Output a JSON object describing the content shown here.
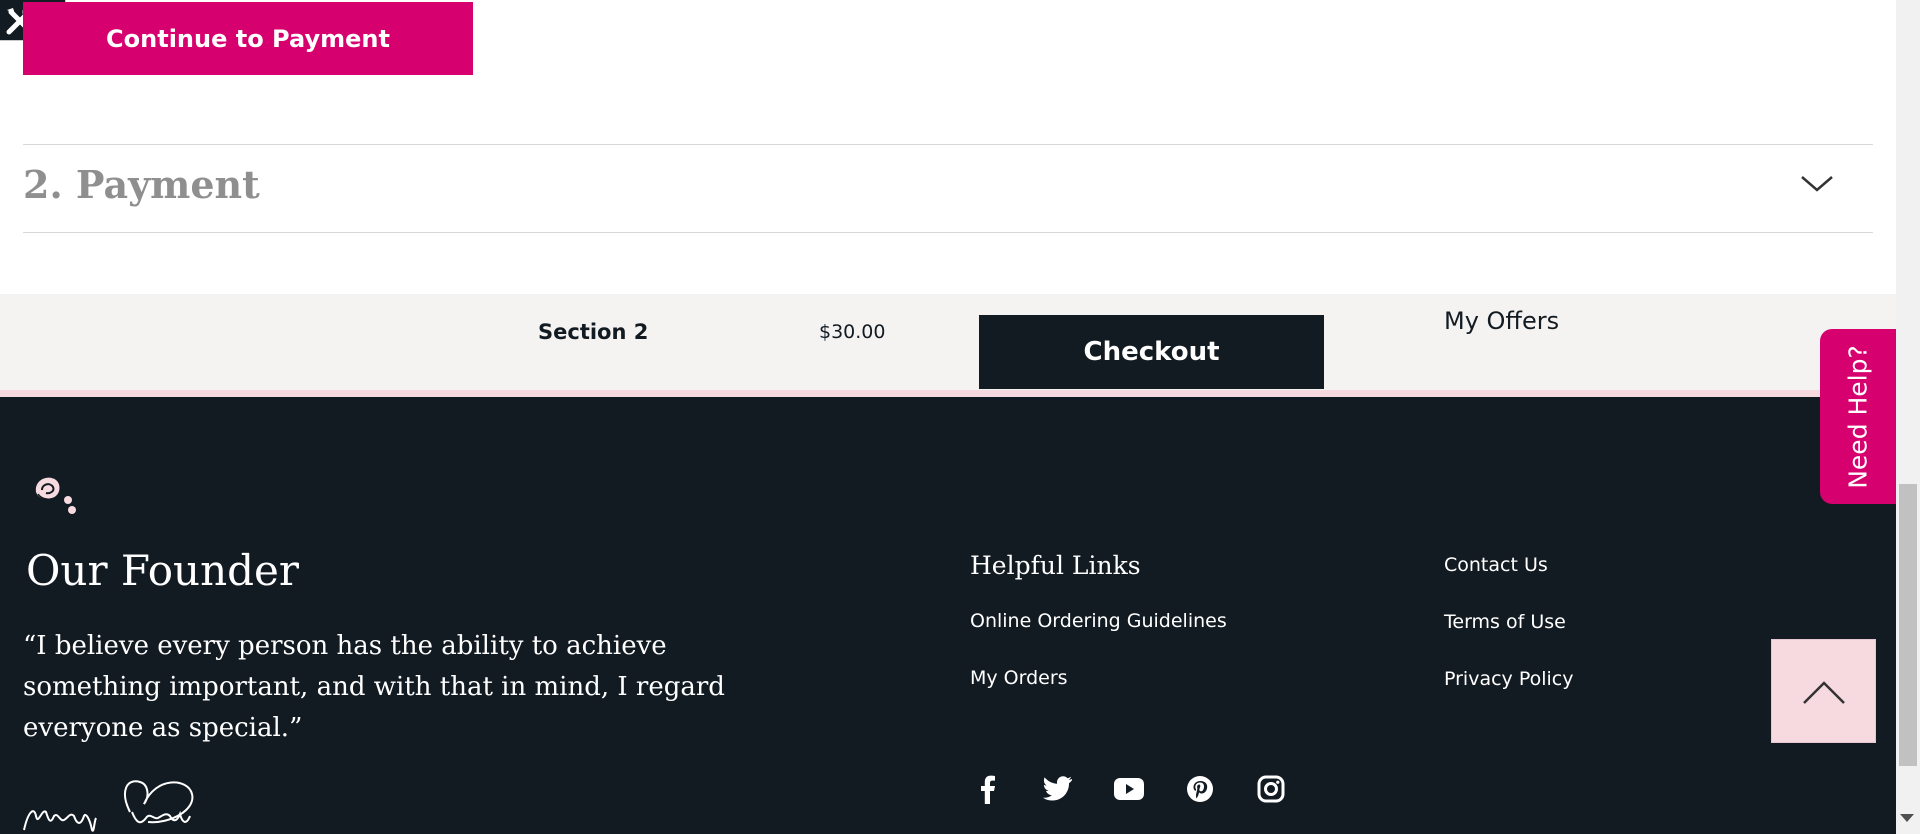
{
  "checkout_step": {
    "continue_button": "Continue to Payment",
    "payment_heading": "2. Payment"
  },
  "summary": {
    "section_label": "Section 2",
    "price": "$30.00",
    "checkout_button": "Checkout",
    "offers_link": "My Offers"
  },
  "footer": {
    "founder_title": "Our Founder",
    "quote": "“I believe every person has the ability to achieve something important, and with that in mind, I regard everyone as special.”",
    "signature": "Mary Kay",
    "helpful_links_title": "Helpful Links",
    "helpful_links": [
      "Online Ordering Guidelines",
      "My Orders"
    ],
    "legal_links": [
      "Contact Us",
      "Terms of Use",
      "Privacy Policy"
    ],
    "social_icons": [
      "facebook-icon",
      "twitter-icon",
      "youtube-icon",
      "pinterest-icon",
      "instagram-icon"
    ]
  },
  "widgets": {
    "need_help": "Need Help?",
    "back_to_top_icon": "chevron-up-icon"
  },
  "colors": {
    "brand_pink": "#d6006f",
    "dark_navy": "#121a22",
    "light_pink": "#f7d9e0",
    "summary_bg": "#f4f3f2"
  }
}
